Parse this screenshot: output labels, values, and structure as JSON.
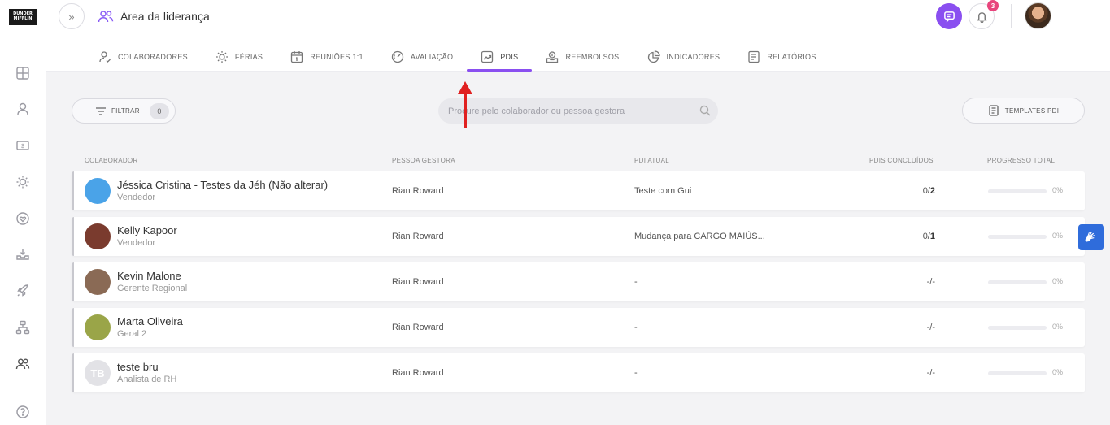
{
  "brand": {
    "logo_text": "DUNDER MIFFLIN"
  },
  "sidebar": {
    "items": [
      {
        "icon": "dashboard-icon"
      },
      {
        "icon": "user-icon"
      },
      {
        "icon": "money-icon"
      },
      {
        "icon": "sun-icon"
      },
      {
        "icon": "heart-shield-icon"
      },
      {
        "icon": "inbox-download-icon"
      },
      {
        "icon": "rocket-icon"
      },
      {
        "icon": "org-chart-icon"
      },
      {
        "icon": "people-icon"
      },
      {
        "icon": "help-icon"
      }
    ]
  },
  "header": {
    "title": "Área da liderança",
    "notifications_count": "3",
    "collapse_glyph": "»"
  },
  "tabs": [
    {
      "label": "COLABORADORES",
      "icon": "user-check-icon"
    },
    {
      "label": "FÉRIAS",
      "icon": "sun-icon"
    },
    {
      "label": "REUNIÕES 1:1",
      "icon": "calendar-icon"
    },
    {
      "label": "AVALIAÇÃO",
      "icon": "gauge-icon"
    },
    {
      "label": "PDIS",
      "icon": "trend-icon",
      "active": true
    },
    {
      "label": "REEMBOLSOS",
      "icon": "receipt-icon"
    },
    {
      "label": "INDICADORES",
      "icon": "pie-chart-icon"
    },
    {
      "label": "RELATÓRIOS",
      "icon": "report-icon"
    }
  ],
  "toolbar": {
    "filter_label": "FILTRAR",
    "filter_count": "0",
    "search_placeholder": "Procure pelo colaborador ou pessoa gestora",
    "templates_label": "TEMPLATES PDI"
  },
  "table": {
    "headers": {
      "collaborator": "COLABORADOR",
      "manager": "PESSOA GESTORA",
      "current_pdi": "PDI ATUAL",
      "completed": "PDIS CONCLUÍDOS",
      "progress": "PROGRESSO TOTAL"
    },
    "rows": [
      {
        "name": "Jéssica Cristina - Testes da Jéh (Não alterar)",
        "role": "Vendedor",
        "manager": "Rian Roward",
        "pdi": "Teste com Gui",
        "done_a": "0/",
        "done_b": "2",
        "progress": 0,
        "pct": "0%",
        "avatar_color": "#4aa3e8",
        "initials": ""
      },
      {
        "name": "Kelly Kapoor",
        "role": "Vendedor",
        "manager": "Rian Roward",
        "pdi": "Mudança para CARGO MAIÚS...",
        "done_a": "0/",
        "done_b": "1",
        "progress": 0,
        "pct": "0%",
        "avatar_color": "#7a3b2e",
        "initials": ""
      },
      {
        "name": "Kevin Malone",
        "role": "Gerente Regional",
        "manager": "Rian Roward",
        "pdi": "-",
        "done_a": "-/-",
        "done_b": "",
        "progress": 0,
        "pct": "0%",
        "avatar_color": "#8a6a55",
        "initials": ""
      },
      {
        "name": "Marta Oliveira",
        "role": "Geral 2",
        "manager": "Rian Roward",
        "pdi": "-",
        "done_a": "-/-",
        "done_b": "",
        "progress": 0,
        "pct": "0%",
        "avatar_color": "#9aa548",
        "initials": ""
      },
      {
        "name": "teste bru",
        "role": "Analista de RH",
        "manager": "Rian Roward",
        "pdi": "-",
        "done_a": "-/-",
        "done_b": "",
        "progress": 0,
        "pct": "0%",
        "avatar_color": "#e2e2e6",
        "initials": "TB"
      }
    ]
  },
  "colors": {
    "accent": "#8a4ff0",
    "badge": "#e8457c",
    "annotation": "#e02020",
    "accessibility": "#2f6cdb"
  }
}
